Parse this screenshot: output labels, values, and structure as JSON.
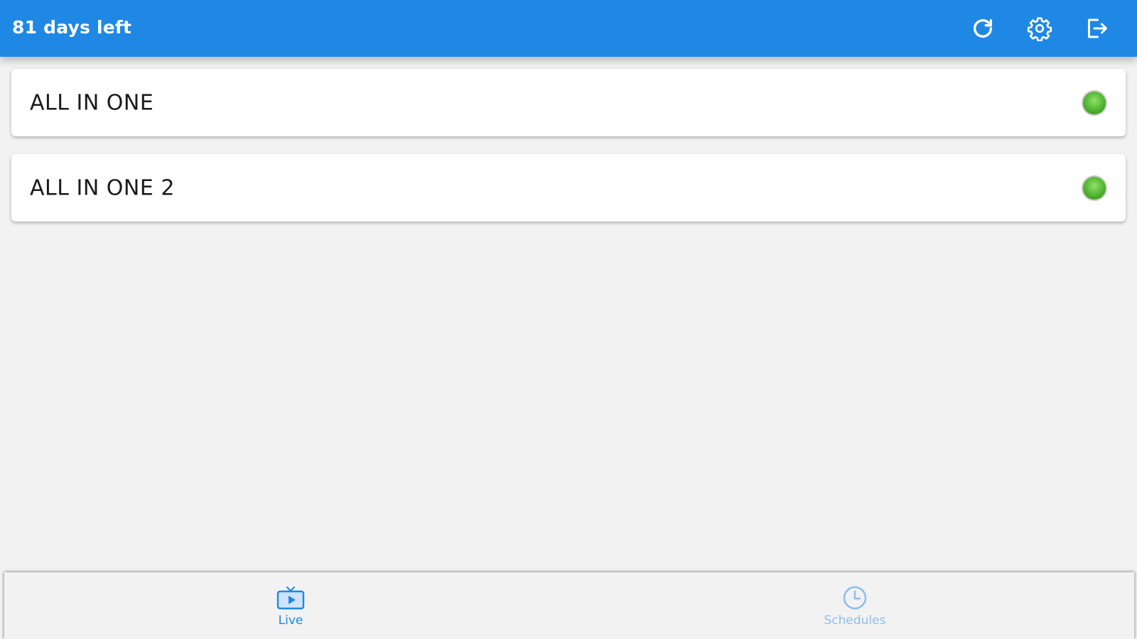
{
  "header": {
    "title": "81 days left",
    "actions": [
      {
        "name": "refresh",
        "icon": "refresh-icon"
      },
      {
        "name": "settings",
        "icon": "gear-icon"
      },
      {
        "name": "logout",
        "icon": "logout-icon"
      }
    ]
  },
  "playlists": [
    {
      "label": "ALL IN ONE",
      "status": "online"
    },
    {
      "label": "ALL IN ONE 2",
      "status": "online"
    }
  ],
  "bottom_nav": {
    "tabs": [
      {
        "label": "Live",
        "icon": "tv-icon",
        "selected": true
      },
      {
        "label": "Schedules",
        "icon": "clock-icon",
        "selected": false
      }
    ]
  },
  "colors": {
    "primary": "#1f88e5",
    "status_online": "#4fb52e",
    "inactive_tab": "#8fbef0",
    "background": "#f2f2f2"
  }
}
